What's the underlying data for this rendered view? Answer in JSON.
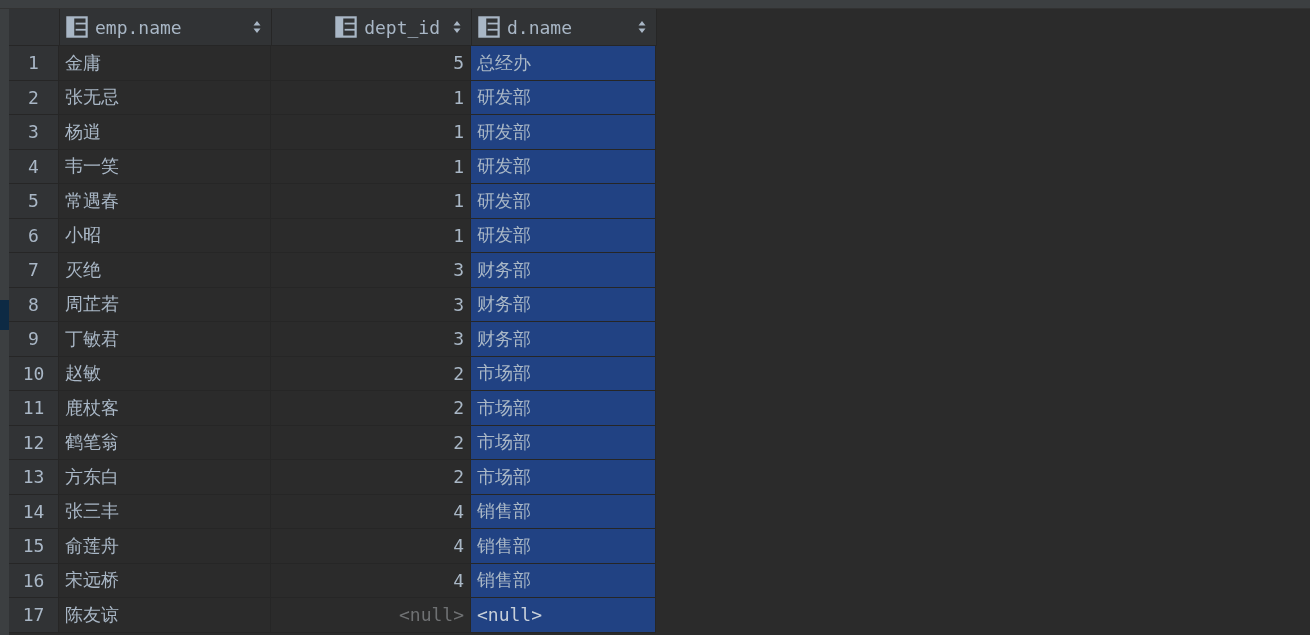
{
  "table": {
    "columns": [
      {
        "label": "emp.name",
        "kind": "text"
      },
      {
        "label": "dept_id",
        "kind": "number"
      },
      {
        "label": "d.name",
        "kind": "text"
      }
    ],
    "rows": [
      {
        "number": "1",
        "emp_name": "金庸",
        "dept_id": {
          "text": "5",
          "is_null": false
        },
        "d_name": {
          "text": "总经办",
          "is_null": false,
          "selected": true
        }
      },
      {
        "number": "2",
        "emp_name": "张无忌",
        "dept_id": {
          "text": "1",
          "is_null": false
        },
        "d_name": {
          "text": "研发部",
          "is_null": false,
          "selected": true
        }
      },
      {
        "number": "3",
        "emp_name": "杨逍",
        "dept_id": {
          "text": "1",
          "is_null": false
        },
        "d_name": {
          "text": "研发部",
          "is_null": false,
          "selected": true
        }
      },
      {
        "number": "4",
        "emp_name": "韦一笑",
        "dept_id": {
          "text": "1",
          "is_null": false
        },
        "d_name": {
          "text": "研发部",
          "is_null": false,
          "selected": true
        }
      },
      {
        "number": "5",
        "emp_name": "常遇春",
        "dept_id": {
          "text": "1",
          "is_null": false
        },
        "d_name": {
          "text": "研发部",
          "is_null": false,
          "selected": true
        }
      },
      {
        "number": "6",
        "emp_name": "小昭",
        "dept_id": {
          "text": "1",
          "is_null": false
        },
        "d_name": {
          "text": "研发部",
          "is_null": false,
          "selected": true
        }
      },
      {
        "number": "7",
        "emp_name": "灭绝",
        "dept_id": {
          "text": "3",
          "is_null": false
        },
        "d_name": {
          "text": "财务部",
          "is_null": false,
          "selected": true
        }
      },
      {
        "number": "8",
        "emp_name": "周芷若",
        "dept_id": {
          "text": "3",
          "is_null": false
        },
        "d_name": {
          "text": "财务部",
          "is_null": false,
          "selected": true
        }
      },
      {
        "number": "9",
        "emp_name": "丁敏君",
        "dept_id": {
          "text": "3",
          "is_null": false
        },
        "d_name": {
          "text": "财务部",
          "is_null": false,
          "selected": true
        }
      },
      {
        "number": "10",
        "emp_name": "赵敏",
        "dept_id": {
          "text": "2",
          "is_null": false
        },
        "d_name": {
          "text": "市场部",
          "is_null": false,
          "selected": true
        }
      },
      {
        "number": "11",
        "emp_name": "鹿杖客",
        "dept_id": {
          "text": "2",
          "is_null": false
        },
        "d_name": {
          "text": "市场部",
          "is_null": false,
          "selected": true
        }
      },
      {
        "number": "12",
        "emp_name": "鹤笔翁",
        "dept_id": {
          "text": "2",
          "is_null": false
        },
        "d_name": {
          "text": "市场部",
          "is_null": false,
          "selected": true
        }
      },
      {
        "number": "13",
        "emp_name": "方东白",
        "dept_id": {
          "text": "2",
          "is_null": false
        },
        "d_name": {
          "text": "市场部",
          "is_null": false,
          "selected": true
        }
      },
      {
        "number": "14",
        "emp_name": "张三丰",
        "dept_id": {
          "text": "4",
          "is_null": false
        },
        "d_name": {
          "text": "销售部",
          "is_null": false,
          "selected": true
        }
      },
      {
        "number": "15",
        "emp_name": "俞莲舟",
        "dept_id": {
          "text": "4",
          "is_null": false
        },
        "d_name": {
          "text": "销售部",
          "is_null": false,
          "selected": true
        }
      },
      {
        "number": "16",
        "emp_name": "宋远桥",
        "dept_id": {
          "text": "4",
          "is_null": false
        },
        "d_name": {
          "text": "销售部",
          "is_null": false,
          "selected": true
        }
      },
      {
        "number": "17",
        "emp_name": "陈友谅",
        "dept_id": {
          "text": "<null>",
          "is_null": true
        },
        "d_name": {
          "text": "<null>",
          "is_null": true,
          "selected": true
        }
      }
    ]
  }
}
